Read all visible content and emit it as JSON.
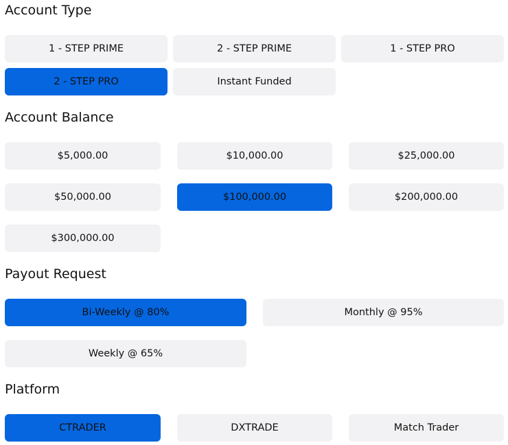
{
  "account_type": {
    "heading": "Account Type",
    "options": [
      "1 - STEP PRIME",
      "2 - STEP PRIME",
      "1 - STEP PRO",
      "2 - STEP PRO",
      "Instant Funded"
    ],
    "selected": "2 - STEP PRO"
  },
  "account_balance": {
    "heading": "Account Balance",
    "options": [
      "$5,000.00",
      "$10,000.00",
      "$25,000.00",
      "$50,000.00",
      "$100,000.00",
      "$200,000.00",
      "$300,000.00"
    ],
    "selected": "$100,000.00"
  },
  "payout_request": {
    "heading": "Payout Request",
    "options": [
      "Bi-Weekly @ 80%",
      "Monthly @ 95%",
      "Weekly @ 65%"
    ],
    "selected": "Bi-Weekly @ 80%"
  },
  "platform": {
    "heading": "Platform",
    "options": [
      "CTRADER",
      "DXTRADE",
      "Match Trader"
    ],
    "selected": "CTRADER"
  },
  "colors": {
    "selected_bg": "#0566e0",
    "option_bg": "#f2f2f4"
  }
}
